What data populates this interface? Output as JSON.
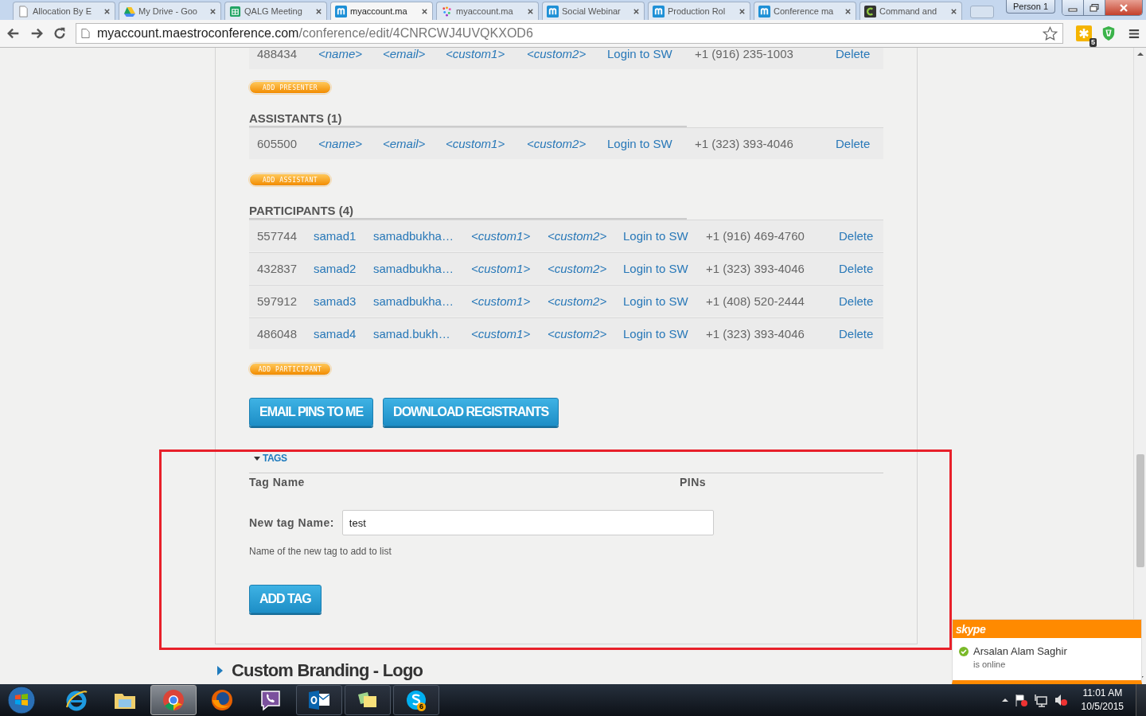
{
  "browser": {
    "tabs": [
      {
        "title": "Allocation By E",
        "selected": false
      },
      {
        "title": "My Drive - Goo",
        "selected": false
      },
      {
        "title": "QALG Meeting",
        "selected": false
      },
      {
        "title": "myaccount.ma",
        "selected": true
      },
      {
        "title": "myaccount.ma",
        "selected": false
      },
      {
        "title": "Social Webinar",
        "selected": false
      },
      {
        "title": "Production Rol",
        "selected": false
      },
      {
        "title": "Conference ma",
        "selected": false
      },
      {
        "title": "Command and",
        "selected": false
      }
    ],
    "profile": "Person 1",
    "url_host": "myaccount.maestroconference.com",
    "url_path": "/conference/edit/4CNRCWJ4UVQKXOD6",
    "extension_badge": "5"
  },
  "page": {
    "sections": [
      {
        "add_button": "ADD PRESENTER",
        "rows": [
          [
            {
              "text": "488434",
              "kind": "plain"
            },
            {
              "text": "<name>",
              "kind": "placeholder"
            },
            {
              "text": "<email>",
              "kind": "placeholder"
            },
            {
              "text": "<custom1>",
              "kind": "placeholder"
            },
            {
              "text": "<custom2>",
              "kind": "placeholder"
            },
            {
              "text": "Login to SW",
              "kind": "link"
            },
            {
              "text": "+1 (916) 235-1003",
              "kind": "plain"
            },
            {
              "text": "Delete",
              "kind": "link"
            }
          ]
        ]
      },
      {
        "heading": "ASSISTANTS (1)",
        "add_button": "ADD ASSISTANT",
        "rows": [
          [
            {
              "text": "605500",
              "kind": "plain"
            },
            {
              "text": "<name>",
              "kind": "placeholder"
            },
            {
              "text": "<email>",
              "kind": "placeholder"
            },
            {
              "text": "<custom1>",
              "kind": "placeholder"
            },
            {
              "text": "<custom2>",
              "kind": "placeholder"
            },
            {
              "text": "Login to SW",
              "kind": "link"
            },
            {
              "text": "+1 (323) 393-4046",
              "kind": "plain"
            },
            {
              "text": "Delete",
              "kind": "link"
            }
          ]
        ]
      },
      {
        "heading": "PARTICIPANTS (4)",
        "add_button": "ADD PARTICIPANT",
        "rows": [
          [
            {
              "text": "557744",
              "kind": "plain"
            },
            {
              "text": "samad1",
              "kind": "link"
            },
            {
              "text": "samadbukha…",
              "kind": "link"
            },
            {
              "text": "<custom1>",
              "kind": "placeholder"
            },
            {
              "text": "<custom2>",
              "kind": "placeholder"
            },
            {
              "text": "Login to SW",
              "kind": "link"
            },
            {
              "text": "+1 (916) 469-4760",
              "kind": "plain"
            },
            {
              "text": "Delete",
              "kind": "link"
            }
          ],
          [
            {
              "text": "432837",
              "kind": "plain"
            },
            {
              "text": "samad2",
              "kind": "link"
            },
            {
              "text": "samadbukha…",
              "kind": "link"
            },
            {
              "text": "<custom1>",
              "kind": "placeholder"
            },
            {
              "text": "<custom2>",
              "kind": "placeholder"
            },
            {
              "text": "Login to SW",
              "kind": "link"
            },
            {
              "text": "+1 (323) 393-4046",
              "kind": "plain"
            },
            {
              "text": "Delete",
              "kind": "link"
            }
          ],
          [
            {
              "text": "597912",
              "kind": "plain"
            },
            {
              "text": "samad3",
              "kind": "link"
            },
            {
              "text": "samadbukha…",
              "kind": "link"
            },
            {
              "text": "<custom1>",
              "kind": "placeholder"
            },
            {
              "text": "<custom2>",
              "kind": "placeholder"
            },
            {
              "text": "Login to SW",
              "kind": "link"
            },
            {
              "text": "+1 (408) 520-2444",
              "kind": "plain"
            },
            {
              "text": "Delete",
              "kind": "link"
            }
          ],
          [
            {
              "text": "486048",
              "kind": "plain"
            },
            {
              "text": "samad4",
              "kind": "link"
            },
            {
              "text": "samad.bukh…",
              "kind": "link"
            },
            {
              "text": "<custom1>",
              "kind": "placeholder"
            },
            {
              "text": "<custom2>",
              "kind": "placeholder"
            },
            {
              "text": "Login to SW",
              "kind": "link"
            },
            {
              "text": "+1 (323) 393-4046",
              "kind": "plain"
            },
            {
              "text": "Delete",
              "kind": "link"
            }
          ]
        ]
      }
    ],
    "actions": [
      "EMAIL PINS TO ME",
      "DOWNLOAD REGISTRANTS"
    ],
    "tags": {
      "toggle": "TAGS",
      "expanded": true,
      "columns": [
        "Tag Name",
        "PINs"
      ],
      "field_label": "New tag Name:",
      "field_value": "test",
      "help": "Name of the new tag to add to list",
      "button": "ADD TAG"
    },
    "next_section": {
      "title": "Custom Branding - Logo",
      "expanded": false
    }
  },
  "notification": {
    "app": "skype",
    "name": "Arsalan Alam Saghir",
    "status": "is online",
    "online": true
  },
  "taskbar": {
    "items": [
      {
        "kind": "ie",
        "selected": false,
        "running": false
      },
      {
        "kind": "folder",
        "selected": false,
        "running": false
      },
      {
        "kind": "chrome",
        "selected": true,
        "running": true
      },
      {
        "kind": "firefox",
        "selected": false,
        "running": false
      },
      {
        "kind": "viber",
        "selected": false,
        "running": false
      },
      {
        "kind": "outlook",
        "selected": false,
        "running": true
      },
      {
        "kind": "notes",
        "selected": false,
        "running": true
      },
      {
        "kind": "skype",
        "selected": false,
        "running": true,
        "badge": "6"
      }
    ],
    "clock_time": "11:01 AM",
    "clock_date": "10/5/2015"
  }
}
